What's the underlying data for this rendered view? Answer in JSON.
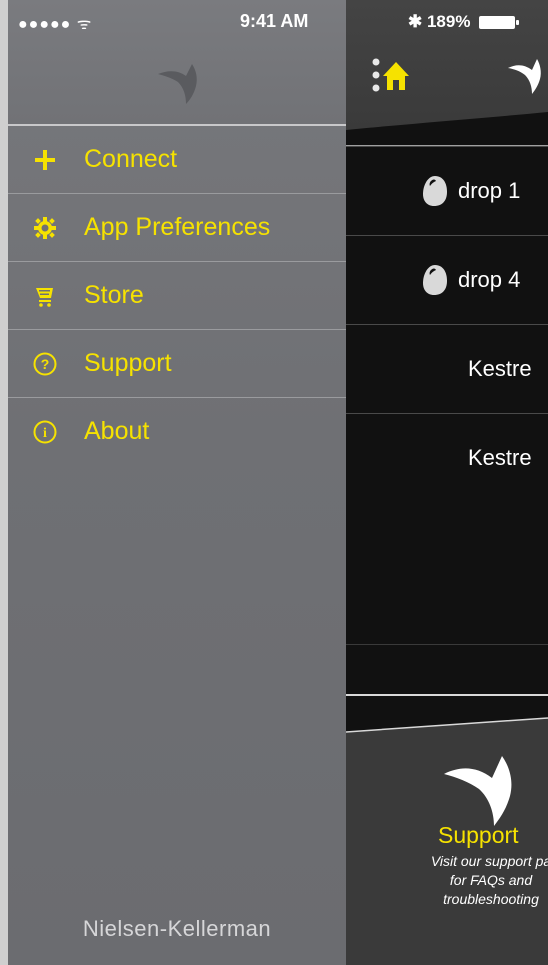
{
  "status_bar": {
    "signal_and_wifi": "●●●●● ᯤ",
    "time": "9:41 AM",
    "bluetooth_battery": "✱ 189%"
  },
  "drawer": {
    "menu": [
      {
        "label": "Connect",
        "icon": "plus-icon"
      },
      {
        "label": "App Preferences",
        "icon": "gear-icon"
      },
      {
        "label": "Store",
        "icon": "cart-icon"
      },
      {
        "label": "Support",
        "icon": "question-icon"
      },
      {
        "label": "About",
        "icon": "info-icon"
      }
    ],
    "footer": "Nielsen-Kellerman"
  },
  "main": {
    "devices": [
      {
        "label": "drop 1",
        "icon": "drop-icon"
      },
      {
        "label": "drop 4",
        "icon": "drop-icon"
      },
      {
        "label": "Kestre",
        "icon": ""
      },
      {
        "label": "Kestre",
        "icon": ""
      }
    ],
    "support": {
      "title": "Support",
      "line1": "Visit our support pa",
      "line2": "for FAQs and",
      "line3": "troubleshooting"
    }
  },
  "colors": {
    "accent": "#f6e200",
    "drawer_bg": "#707175",
    "main_bg": "#111111"
  }
}
